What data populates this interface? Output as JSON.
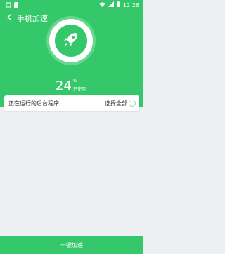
{
  "status_bar": {
    "time": "12:26",
    "icons": [
      "notification-icon",
      "sd-card-icon",
      "wifi-icon",
      "signal-icon",
      "battery-icon"
    ]
  },
  "app_bar": {
    "back_icon": "chevron-left-icon",
    "title": "手机加速"
  },
  "boost": {
    "icon": "rocket-icon",
    "percent_value": "24",
    "percent_symbol": "%",
    "caption": "已使用"
  },
  "process_card": {
    "label": "正在运行的后台程序",
    "select_all": "选择全部",
    "loading_icon": "spinner-icon"
  },
  "footer": {
    "button_label": "一键加速"
  },
  "colors": {
    "brand_green": "#34c86a",
    "background": "#eeeff2"
  }
}
